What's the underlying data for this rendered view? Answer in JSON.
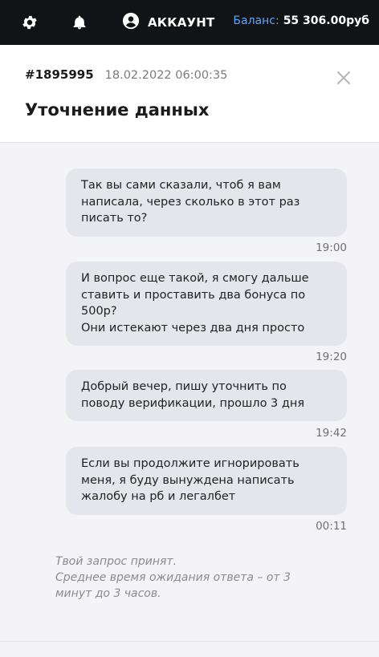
{
  "topbar": {
    "account_label": "АККАУНТ",
    "balance_label": "Баланс:",
    "balance_value": "55 306.00руб",
    "colors": {
      "background": "#111317",
      "balance_label": "#5aa6ff"
    },
    "icons": [
      "gear-icon",
      "bell-icon",
      "account-icon"
    ]
  },
  "ticket": {
    "id": "#1895995",
    "datetime": "18.02.2022 06:00:35",
    "title": "Уточнение данных"
  },
  "messages": [
    {
      "text": "Так вы сами сказали, чтоб я вам написала, через сколько в этот раз писать то?",
      "time": "19:00"
    },
    {
      "text": "И вопрос еще такой, я смогу дальше ставить и проставить два бонуса по 500р?\nОни истекают через два дня просто",
      "time": "19:20"
    },
    {
      "text": "Добрый вечер, пишу уточнить по поводу верификации, прошло 3 дня",
      "time": "19:42"
    },
    {
      "text": "Если вы продолжите игнорировать меня, я буду вынуждена написать жалобу на рб и легалбет",
      "time": "00:11"
    }
  ],
  "status_note": "Твой запрос принят.\nСреднее время ожидания ответа – от 3 минут до 3 часов."
}
